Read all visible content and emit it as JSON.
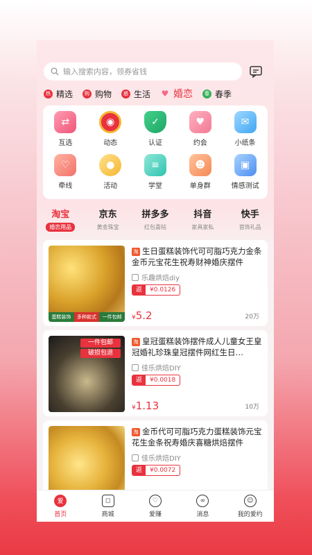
{
  "search": {
    "placeholder": "输入搜索内容，领券省钱"
  },
  "top_tabs": [
    {
      "badge": "热",
      "label": "精选"
    },
    {
      "badge": "购",
      "label": "购物"
    },
    {
      "badge": "惑",
      "label": "生活"
    },
    {
      "badge": "♥",
      "label": "婚恋"
    },
    {
      "badge": "春",
      "label": "春季"
    }
  ],
  "grid": [
    {
      "label": "互选",
      "icon": "swap-heart-icon"
    },
    {
      "label": "动态",
      "icon": "lips-badge-icon"
    },
    {
      "label": "认证",
      "icon": "shield-check-icon"
    },
    {
      "label": "约会",
      "icon": "couple-icon"
    },
    {
      "label": "小纸条",
      "icon": "envelope-icon"
    },
    {
      "label": "牵线",
      "icon": "matchmaker-icon"
    },
    {
      "label": "活动",
      "icon": "balloons-icon"
    },
    {
      "label": "学堂",
      "icon": "notebook-icon"
    },
    {
      "label": "单身群",
      "icon": "group-icon"
    },
    {
      "label": "情感测试",
      "icon": "test-cards-icon"
    }
  ],
  "malls": [
    {
      "name": "淘宝",
      "sub": "婚恋用品"
    },
    {
      "name": "京东",
      "sub": "黄金珠宝"
    },
    {
      "name": "拼多多",
      "sub": "红包喜帖"
    },
    {
      "name": "抖音",
      "sub": "家具家私"
    },
    {
      "name": "快手",
      "sub": "首饰礼品"
    }
  ],
  "products": [
    {
      "badge": "淘",
      "title": "生日蛋糕装饰代可可脂巧克力金条金币元宝花生祝寿财神婚庆摆件",
      "shop": "乐趣烘焙diy",
      "rebate_label": "返",
      "rebate_value": "¥0.0126",
      "price_symbol": "¥",
      "price": "5.2",
      "sales": "20万",
      "img_tags": [
        "蛋糕装饰",
        "多种款式",
        "一件包邮"
      ]
    },
    {
      "badge": "淘",
      "title": "皇冠蛋糕装饰摆件成人儿童女王皇冠婚礼珍珠皇冠摆件网红生日…",
      "shop": "佳乐烘焙DIY",
      "rebate_label": "返",
      "rebate_value": "¥0.0018",
      "price_symbol": "¥",
      "price": "1.13",
      "sales": "10万",
      "img_tags": [
        "一件包邮",
        "破损包退"
      ]
    },
    {
      "badge": "淘",
      "title": "金币代可可脂巧克力蛋糕装饰元宝花生金条祝寿婚庆喜糖烘焙摆件",
      "shop": "佳乐烘焙DIY",
      "rebate_label": "返",
      "rebate_value": "¥0.0072",
      "price_symbol": "",
      "price": "",
      "sales": "",
      "img_tags": []
    }
  ],
  "tabbar": [
    {
      "label": "首页",
      "glyph": "爱"
    },
    {
      "label": "商城",
      "glyph": "◻"
    },
    {
      "label": "爱赚",
      "glyph": "♡"
    },
    {
      "label": "消息",
      "glyph": "∞"
    },
    {
      "label": "我的爱约",
      "glyph": "☺"
    }
  ],
  "colors": {
    "accent": "#e8323e",
    "bg_pink": "#fde7ea"
  }
}
